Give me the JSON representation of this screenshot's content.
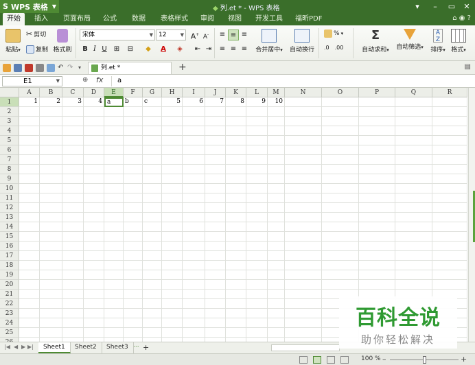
{
  "app": {
    "button_label": "WPS 表格",
    "window_title": "列.et * - WPS 表格",
    "controls": [
      "▾",
      "–",
      "▭",
      "✕"
    ]
  },
  "menu": {
    "tabs": [
      "开始",
      "插入",
      "页面布局",
      "公式",
      "数据",
      "表格样式",
      "审阅",
      "视图",
      "开发工具",
      "福昕PDF"
    ],
    "active_tab": "开始",
    "right": "⌂ ◉ ?"
  },
  "ribbon": {
    "paste": "粘贴",
    "cut": "剪切",
    "copy": "复制",
    "format_painter": "格式刷",
    "font_name": "宋体",
    "font_size": "12",
    "bold": "B",
    "italic": "I",
    "underline": "U",
    "increase_font": "A",
    "decrease_font": "A",
    "merge_center": "合并居中",
    "wrap_text": "自动换行",
    "percent": "%",
    "autosum": "自动求和",
    "autofilter": "自动筛选",
    "sort": "排序",
    "format": "格式"
  },
  "document": {
    "tab_name": "列.et *"
  },
  "formula_bar": {
    "cell_ref": "E1",
    "fx": "fx",
    "value": "a"
  },
  "grid": {
    "columns": [
      "A",
      "B",
      "C",
      "D",
      "E",
      "F",
      "G",
      "H",
      "I",
      "J",
      "K",
      "L",
      "M",
      "N",
      "O",
      "P",
      "Q",
      "R"
    ],
    "rows": [
      "1",
      "2",
      "3",
      "4",
      "5",
      "6",
      "7",
      "8",
      "9",
      "10",
      "11",
      "12",
      "13",
      "14",
      "15",
      "16",
      "17",
      "18",
      "19",
      "20",
      "21",
      "22",
      "23",
      "24",
      "25",
      "26"
    ],
    "selected_column": "E",
    "selected_row": "1",
    "row1_values": [
      "1",
      "2",
      "3",
      "4",
      "a",
      "b",
      "c",
      "5",
      "6",
      "7",
      "8",
      "9",
      "10"
    ]
  },
  "sheets": {
    "tabs": [
      "Sheet1",
      "Sheet2",
      "Sheet3"
    ],
    "active": "Sheet1",
    "more": "···",
    "add": "+"
  },
  "status": {
    "zoom": "100 %"
  },
  "watermark": {
    "main": "百科全说",
    "sub": "助你轻松解决"
  },
  "colors": {
    "accent": "#4e8a33",
    "titlebar": "#3a6e2a",
    "watermark": "#2f9a32"
  }
}
